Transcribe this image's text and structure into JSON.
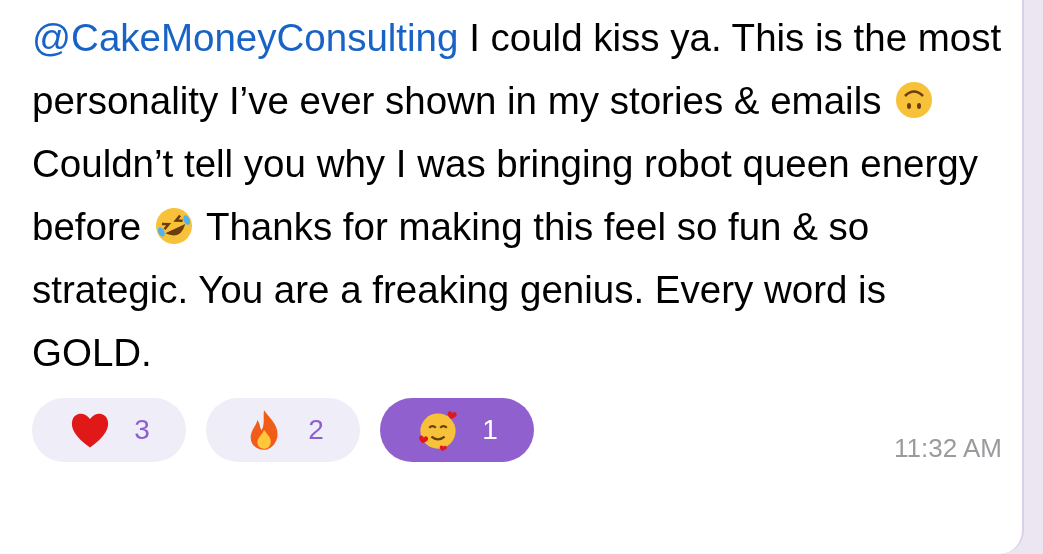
{
  "message": {
    "parts": [
      {
        "kind": "mention",
        "text": "@CakeMoneyConsulting"
      },
      {
        "kind": "text",
        "text": " I could kiss ya. This is the most personality I’ve ever shown in my stories & emails "
      },
      {
        "kind": "upside_down_face"
      },
      {
        "kind": "text",
        "text": " Couldn’t tell you why I was bringing robot queen energy before "
      },
      {
        "kind": "rolling_laughing_face"
      },
      {
        "kind": "text",
        "text": " Thanks for making this feel so fun & so strategic. You are a freaking genius. Every word is GOLD."
      }
    ],
    "reactions": [
      {
        "kind": "heart",
        "count": "3",
        "selected": false
      },
      {
        "kind": "fire",
        "count": "2",
        "selected": false
      },
      {
        "kind": "hearts_face",
        "count": "1",
        "selected": true
      }
    ],
    "time": "11:32 AM"
  }
}
